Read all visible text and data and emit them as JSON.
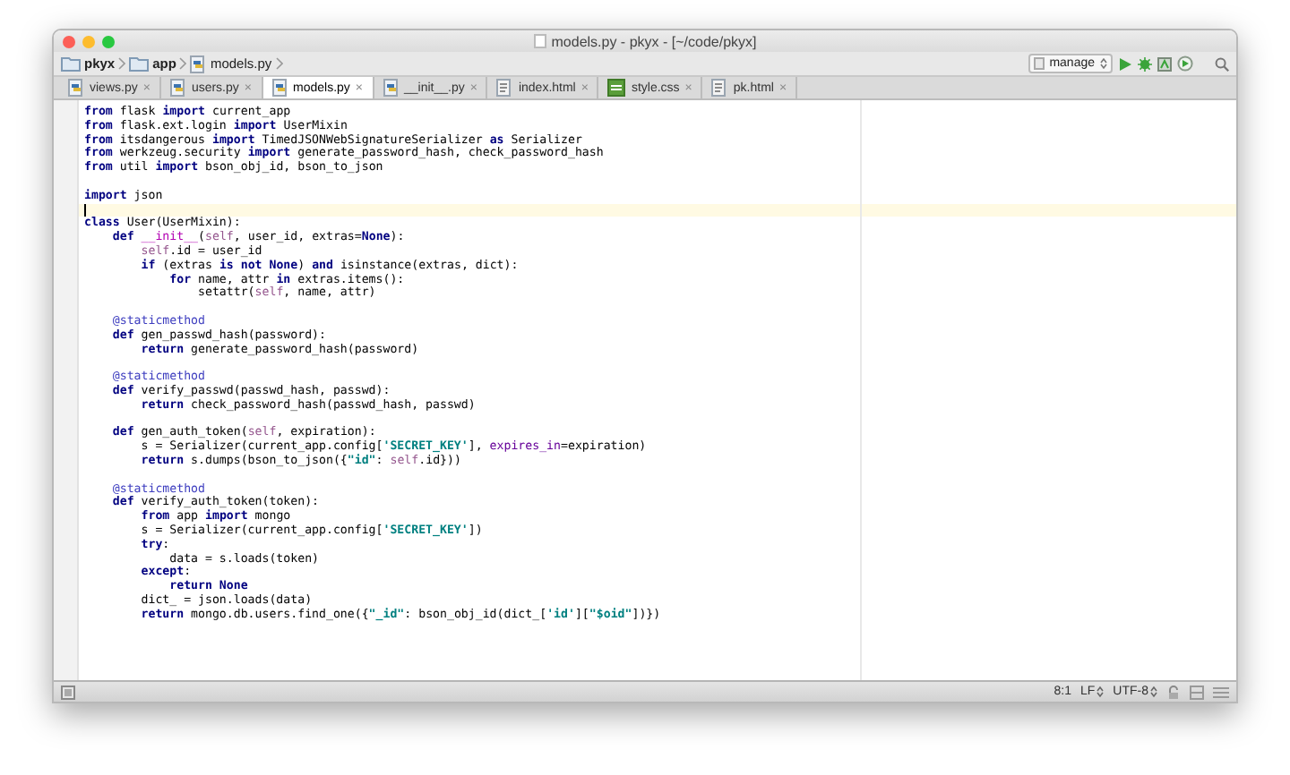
{
  "window": {
    "title": "models.py - pkyx - [~/code/pkyx]"
  },
  "breadcrumbs": [
    {
      "label": "pkyx",
      "kind": "folder"
    },
    {
      "label": "app",
      "kind": "folder"
    },
    {
      "label": "models.py",
      "kind": "python"
    }
  ],
  "run_config": {
    "label": "manage"
  },
  "tabs": [
    {
      "label": "views.py",
      "kind": "python",
      "selected": false,
      "close": "×"
    },
    {
      "label": "users.py",
      "kind": "python",
      "selected": false,
      "close": "×"
    },
    {
      "label": "models.py",
      "kind": "python",
      "selected": true,
      "close": "×"
    },
    {
      "label": "__init__.py",
      "kind": "python",
      "selected": false,
      "close": "×"
    },
    {
      "label": "index.html",
      "kind": "html",
      "selected": false,
      "close": "×"
    },
    {
      "label": "style.css",
      "kind": "css",
      "selected": false,
      "close": "×"
    },
    {
      "label": "pk.html",
      "kind": "html",
      "selected": false,
      "close": "×"
    }
  ],
  "code_lines": [
    {
      "current": false,
      "tokens": [
        {
          "kind": "keyword",
          "text": "from"
        },
        {
          "kind": "plain",
          "text": " flask "
        },
        {
          "kind": "keyword",
          "text": "import"
        },
        {
          "kind": "plain",
          "text": " current_app"
        }
      ]
    },
    {
      "current": false,
      "tokens": [
        {
          "kind": "keyword",
          "text": "from"
        },
        {
          "kind": "plain",
          "text": " flask.ext.login "
        },
        {
          "kind": "keyword",
          "text": "import"
        },
        {
          "kind": "plain",
          "text": " UserMixin"
        }
      ]
    },
    {
      "current": false,
      "tokens": [
        {
          "kind": "keyword",
          "text": "from"
        },
        {
          "kind": "plain",
          "text": " itsdangerous "
        },
        {
          "kind": "keyword",
          "text": "import"
        },
        {
          "kind": "plain",
          "text": " TimedJSONWebSignatureSerializer "
        },
        {
          "kind": "keyword",
          "text": "as"
        },
        {
          "kind": "plain",
          "text": " Serializer"
        }
      ]
    },
    {
      "current": false,
      "tokens": [
        {
          "kind": "keyword",
          "text": "from"
        },
        {
          "kind": "plain",
          "text": " werkzeug.security "
        },
        {
          "kind": "keyword",
          "text": "import"
        },
        {
          "kind": "plain",
          "text": " generate_password_hash, check_password_hash"
        }
      ]
    },
    {
      "current": false,
      "tokens": [
        {
          "kind": "keyword",
          "text": "from"
        },
        {
          "kind": "plain",
          "text": " util "
        },
        {
          "kind": "keyword",
          "text": "import"
        },
        {
          "kind": "plain",
          "text": " bson_obj_id, bson_to_json"
        }
      ]
    },
    {
      "current": false
    },
    {
      "current": false,
      "tokens": [
        {
          "kind": "keyword",
          "text": "import"
        },
        {
          "kind": "plain",
          "text": " json"
        }
      ]
    },
    {
      "current": true
    },
    {
      "current": false,
      "tokens": [
        {
          "kind": "keyword",
          "text": "class"
        },
        {
          "kind": "plain",
          "text": " User(UserMixin):"
        }
      ]
    },
    {
      "current": false,
      "tokens": [
        {
          "kind": "keyword",
          "text": "    def"
        },
        {
          "kind": "magic",
          "text": " __init__"
        },
        {
          "kind": "plain",
          "text": "("
        },
        {
          "kind": "self",
          "text": "self"
        },
        {
          "kind": "plain",
          "text": ", user_id, extras="
        },
        {
          "kind": "keyword",
          "text": "None"
        },
        {
          "kind": "plain",
          "text": "):"
        }
      ]
    },
    {
      "current": false,
      "tokens": [
        {
          "kind": "self",
          "text": "        self"
        },
        {
          "kind": "plain",
          "text": ".id = user_id"
        }
      ]
    },
    {
      "current": false,
      "tokens": [
        {
          "kind": "keyword",
          "text": "        if"
        },
        {
          "kind": "plain",
          "text": " (extras "
        },
        {
          "kind": "keyword",
          "text": "is not None"
        },
        {
          "kind": "plain",
          "text": ") "
        },
        {
          "kind": "keyword",
          "text": "and"
        },
        {
          "kind": "plain",
          "text": " isinstance(extras, dict):"
        }
      ]
    },
    {
      "current": false,
      "tokens": [
        {
          "kind": "keyword",
          "text": "            for"
        },
        {
          "kind": "plain",
          "text": " name, attr "
        },
        {
          "kind": "keyword",
          "text": "in"
        },
        {
          "kind": "plain",
          "text": " extras.items():"
        }
      ]
    },
    {
      "current": false,
      "tokens": [
        {
          "kind": "plain",
          "text": "                setattr("
        },
        {
          "kind": "self",
          "text": "self"
        },
        {
          "kind": "plain",
          "text": ", name, attr)"
        }
      ]
    },
    {
      "current": false
    },
    {
      "current": false,
      "tokens": [
        {
          "kind": "decorator",
          "text": "    @staticmethod"
        }
      ]
    },
    {
      "current": false,
      "tokens": [
        {
          "kind": "keyword",
          "text": "    def"
        },
        {
          "kind": "plain",
          "text": " gen_passwd_hash(password):"
        }
      ]
    },
    {
      "current": false,
      "tokens": [
        {
          "kind": "keyword",
          "text": "        return"
        },
        {
          "kind": "plain",
          "text": " generate_password_hash(password)"
        }
      ]
    },
    {
      "current": false
    },
    {
      "current": false,
      "tokens": [
        {
          "kind": "decorator",
          "text": "    @staticmethod"
        }
      ]
    },
    {
      "current": false,
      "tokens": [
        {
          "kind": "keyword",
          "text": "    def"
        },
        {
          "kind": "plain",
          "text": " verify_passwd(passwd_hash, passwd):"
        }
      ]
    },
    {
      "current": false,
      "tokens": [
        {
          "kind": "keyword",
          "text": "        return"
        },
        {
          "kind": "plain",
          "text": " check_password_hash(passwd_hash, passwd)"
        }
      ]
    },
    {
      "current": false
    },
    {
      "current": false,
      "tokens": [
        {
          "kind": "keyword",
          "text": "    def"
        },
        {
          "kind": "plain",
          "text": " gen_auth_token("
        },
        {
          "kind": "self",
          "text": "self"
        },
        {
          "kind": "plain",
          "text": ", expiration):"
        }
      ]
    },
    {
      "current": false,
      "tokens": [
        {
          "kind": "plain",
          "text": "        s = Serializer(current_app.config["
        },
        {
          "kind": "string",
          "text": "'SECRET_KEY'"
        },
        {
          "kind": "plain",
          "text": "], "
        },
        {
          "kind": "named_arg",
          "text": "expires_in"
        },
        {
          "kind": "plain",
          "text": "=expiration)"
        }
      ]
    },
    {
      "current": false,
      "tokens": [
        {
          "kind": "keyword",
          "text": "        return"
        },
        {
          "kind": "plain",
          "text": " s.dumps(bson_to_json({"
        },
        {
          "kind": "string",
          "text": "\"id\""
        },
        {
          "kind": "plain",
          "text": ": "
        },
        {
          "kind": "self",
          "text": "self"
        },
        {
          "kind": "plain",
          "text": ".id}))"
        }
      ]
    },
    {
      "current": false
    },
    {
      "current": false,
      "tokens": [
        {
          "kind": "decorator",
          "text": "    @staticmethod"
        }
      ]
    },
    {
      "current": false,
      "tokens": [
        {
          "kind": "keyword",
          "text": "    def"
        },
        {
          "kind": "plain",
          "text": " verify_auth_token(token):"
        }
      ]
    },
    {
      "current": false,
      "tokens": [
        {
          "kind": "keyword",
          "text": "        from"
        },
        {
          "kind": "plain",
          "text": " app "
        },
        {
          "kind": "keyword",
          "text": "import"
        },
        {
          "kind": "plain",
          "text": " mongo"
        }
      ]
    },
    {
      "current": false,
      "tokens": [
        {
          "kind": "plain",
          "text": "        s = Serializer(current_app.config["
        },
        {
          "kind": "string",
          "text": "'SECRET_KEY'"
        },
        {
          "kind": "plain",
          "text": "])"
        }
      ]
    },
    {
      "current": false,
      "tokens": [
        {
          "kind": "keyword",
          "text": "        try"
        },
        {
          "kind": "plain",
          "text": ":"
        }
      ]
    },
    {
      "current": false,
      "tokens": [
        {
          "kind": "plain",
          "text": "            data = s.loads(token)"
        }
      ]
    },
    {
      "current": false,
      "tokens": [
        {
          "kind": "keyword",
          "text": "        except"
        },
        {
          "kind": "plain",
          "text": ":"
        }
      ]
    },
    {
      "current": false,
      "tokens": [
        {
          "kind": "keyword",
          "text": "            return None"
        }
      ]
    },
    {
      "current": false,
      "tokens": [
        {
          "kind": "plain",
          "text": "        dict_ = json.loads(data)"
        }
      ]
    },
    {
      "current": false,
      "tokens": [
        {
          "kind": "keyword",
          "text": "        return"
        },
        {
          "kind": "plain",
          "text": " mongo.db.users.find_one({"
        },
        {
          "kind": "string",
          "text": "\"_id\""
        },
        {
          "kind": "plain",
          "text": ": bson_obj_id(dict_["
        },
        {
          "kind": "string",
          "text": "'id'"
        },
        {
          "kind": "plain",
          "text": "]["
        },
        {
          "kind": "string",
          "text": "\"$oid\""
        },
        {
          "kind": "plain",
          "text": "])})"
        }
      ]
    }
  ],
  "status_bar": {
    "position": "8:1",
    "line_separator": "LF",
    "encoding": "UTF-8"
  }
}
